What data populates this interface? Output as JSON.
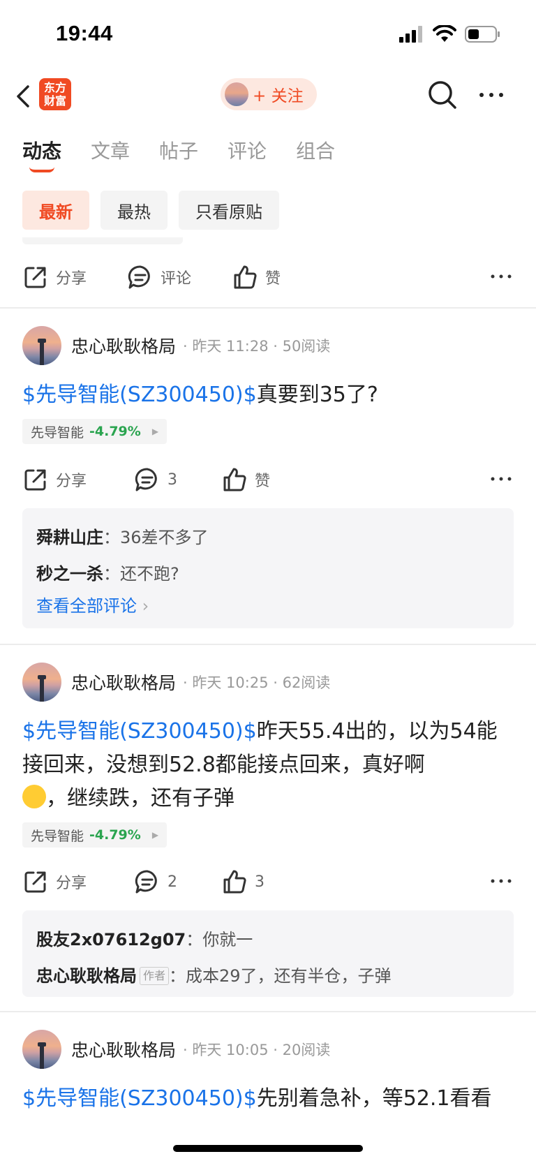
{
  "status": {
    "time": "19:44"
  },
  "nav": {
    "logo_line1": "东方",
    "logo_line2": "财富",
    "follow_label": "+ 关注"
  },
  "tabs": [
    "动态",
    "文章",
    "帖子",
    "评论",
    "组合"
  ],
  "filters": [
    "最新",
    "最热",
    "只看原贴"
  ],
  "prev_actions": {
    "share": "分享",
    "comment": "评论",
    "like": "赞"
  },
  "posts": [
    {
      "author": "忠心耿耿格局",
      "meta": "· 昨天 11:28 · 50阅读",
      "stock_tag": "$先导智能(SZ300450)$",
      "text": "真要到35了?",
      "chip_name": "先导智能",
      "chip_change": "-4.79%",
      "share": "分享",
      "comment_count": "3",
      "like": "赞",
      "comments": [
        {
          "name": "舜耕山庄",
          "text": "36差不多了"
        },
        {
          "name": "秒之一杀",
          "text": "还不跑?"
        }
      ],
      "view_all": "查看全部评论"
    },
    {
      "author": "忠心耿耿格局",
      "meta": "· 昨天 10:25 · 62阅读",
      "stock_tag": "$先导智能(SZ300450)$",
      "text": "昨天55.4出的，以为54能接回来，没想到52.8都能接点回来，真好啊",
      "text2": "，继续跌，还有子弹",
      "chip_name": "先导智能",
      "chip_change": "-4.79%",
      "share": "分享",
      "comment_count": "2",
      "like": "3",
      "comments": [
        {
          "name": "股友2x07612g07",
          "text": "你就一"
        },
        {
          "name": "忠心耿耿格局",
          "tag": "作者",
          "text": "成本29了，还有半仓，子弹"
        }
      ]
    },
    {
      "author": "忠心耿耿格局",
      "meta": "· 昨天 10:05 · 20阅读",
      "stock_tag": "$先导智能(SZ300450)$",
      "text": "先别着急补，等52.1看看"
    }
  ],
  "colors": {
    "accent": "#f04a23",
    "link": "#1a73e8",
    "down": "#2aa44f"
  }
}
